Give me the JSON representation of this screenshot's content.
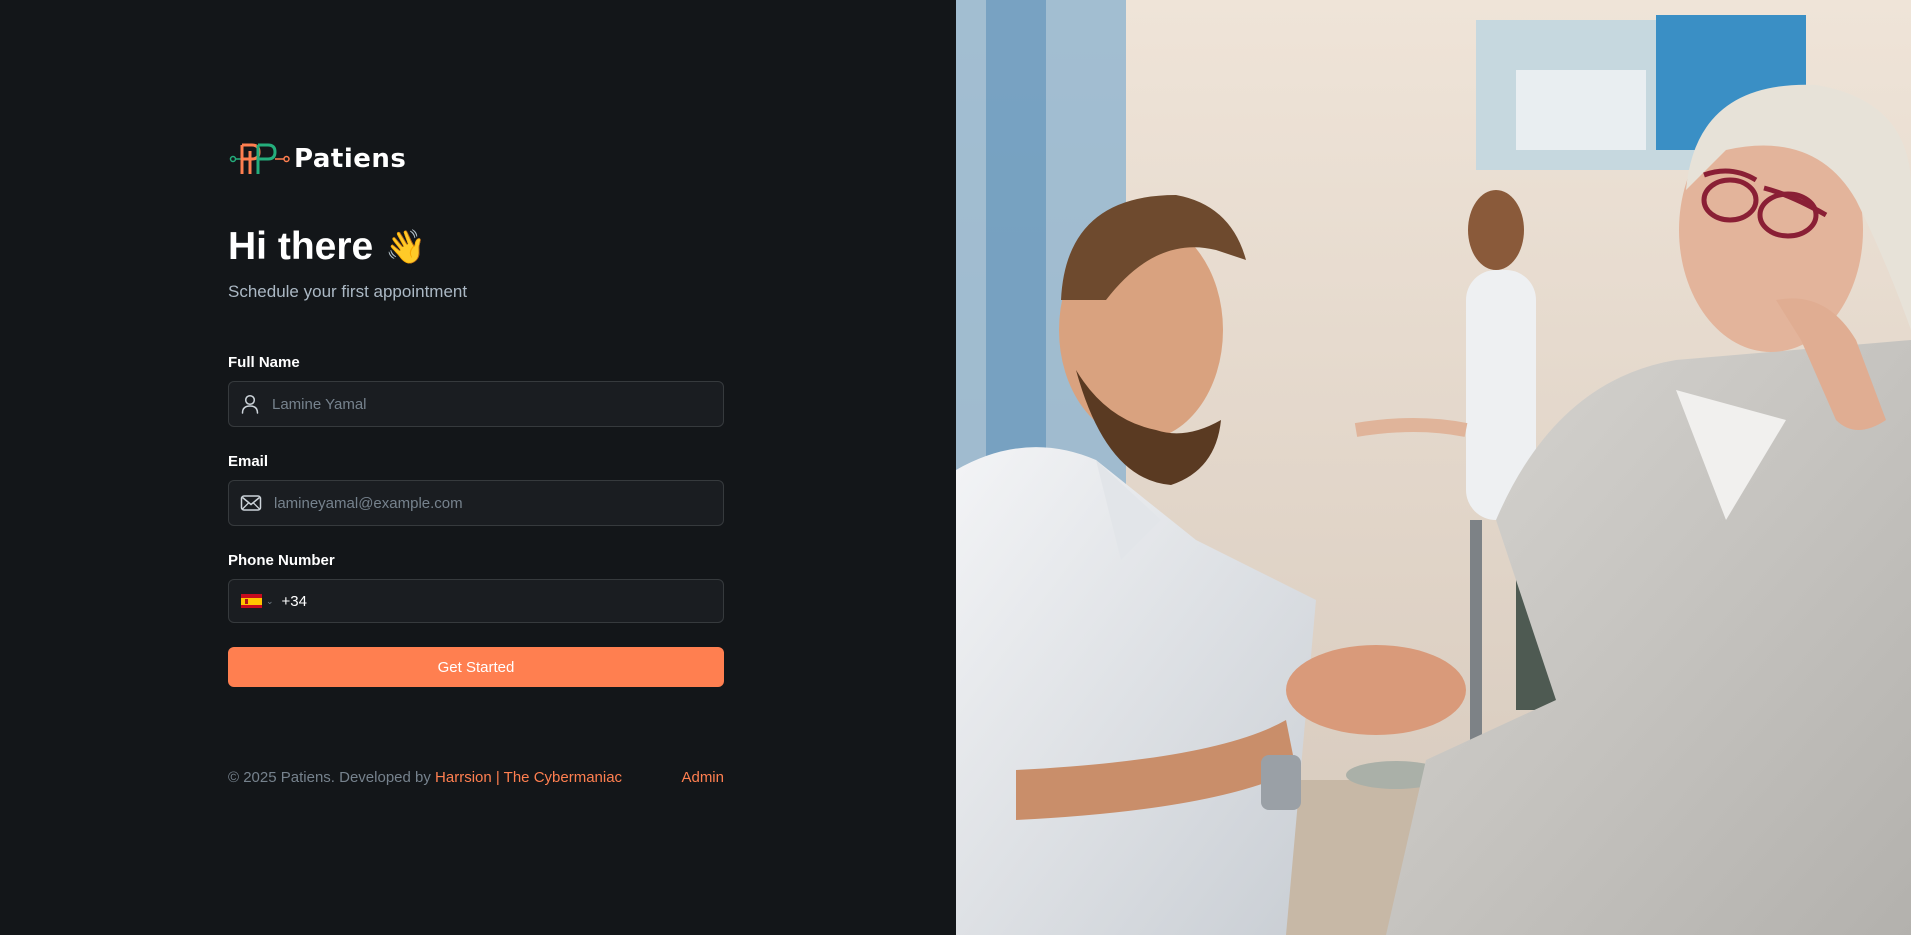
{
  "brand": {
    "name": "Patiens"
  },
  "greeting": {
    "title": "Hi there",
    "emoji": "👋",
    "subtitle": "Schedule your first appointment"
  },
  "form": {
    "full_name": {
      "label": "Full Name",
      "placeholder": "Lamine Yamal",
      "icon": "user-icon"
    },
    "email": {
      "label": "Email",
      "placeholder": "lamineyamal@example.com",
      "icon": "mail-icon"
    },
    "phone": {
      "label": "Phone Number",
      "country_flag": "spain-flag-icon",
      "dial_code": "+34"
    },
    "submit_label": "Get Started"
  },
  "footer": {
    "copyright": "© 2025 Patiens. Developed by",
    "developer": "Harrsion | The Cybermaniac",
    "admin_link": "Admin"
  },
  "colors": {
    "background": "#131619",
    "accent": "#ff7f50",
    "input_bg": "#1a1d21",
    "border": "#363a3d",
    "logo_teal": "#24ae7c"
  }
}
